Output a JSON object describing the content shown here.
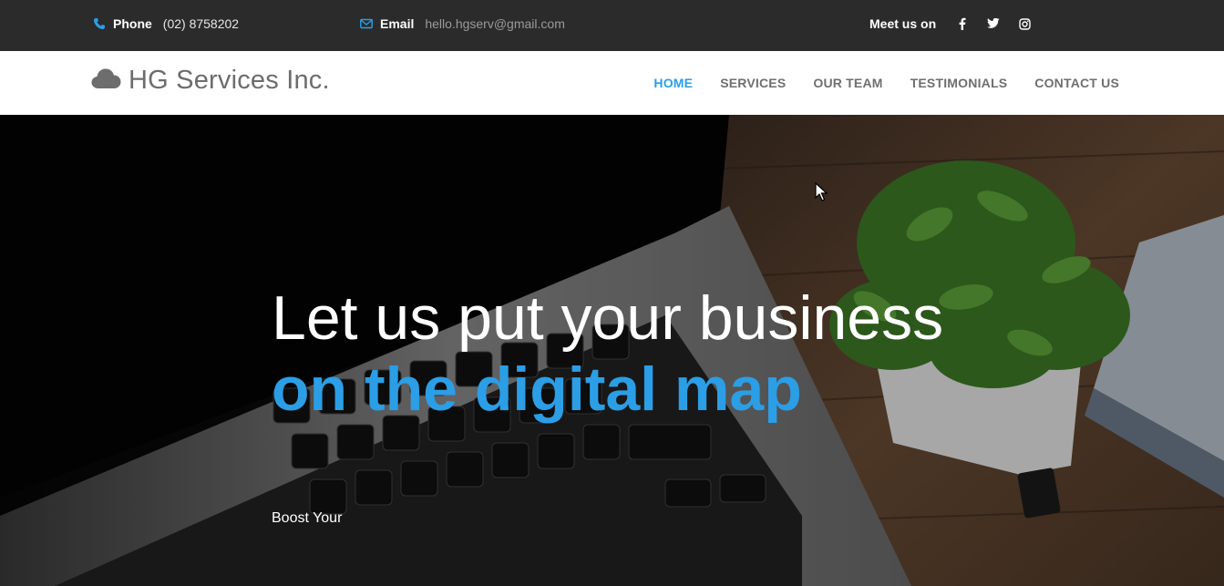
{
  "topbar": {
    "phone_label": "Phone",
    "phone_value": "(02) 8758202",
    "email_label": "Email",
    "email_value": "hello.hgserv@gmail.com",
    "social_label": "Meet us on",
    "social_icons": [
      "facebook-icon",
      "twitter-icon",
      "instagram-icon"
    ]
  },
  "header": {
    "brand": "HG Services Inc.",
    "nav": [
      {
        "label": "HOME",
        "active": true
      },
      {
        "label": "SERVICES",
        "active": false
      },
      {
        "label": "OUR TEAM",
        "active": false
      },
      {
        "label": "TESTIMONIALS",
        "active": false
      },
      {
        "label": "CONTACT US",
        "active": false
      }
    ]
  },
  "hero": {
    "headline_plain": "Let us put your business ",
    "headline_accent": "on the digital map",
    "subline": "Boost Your"
  },
  "colors": {
    "accent": "#2b9ee6",
    "topbar_bg": "#2b2b2b",
    "nav_text": "#6f6f6f"
  }
}
